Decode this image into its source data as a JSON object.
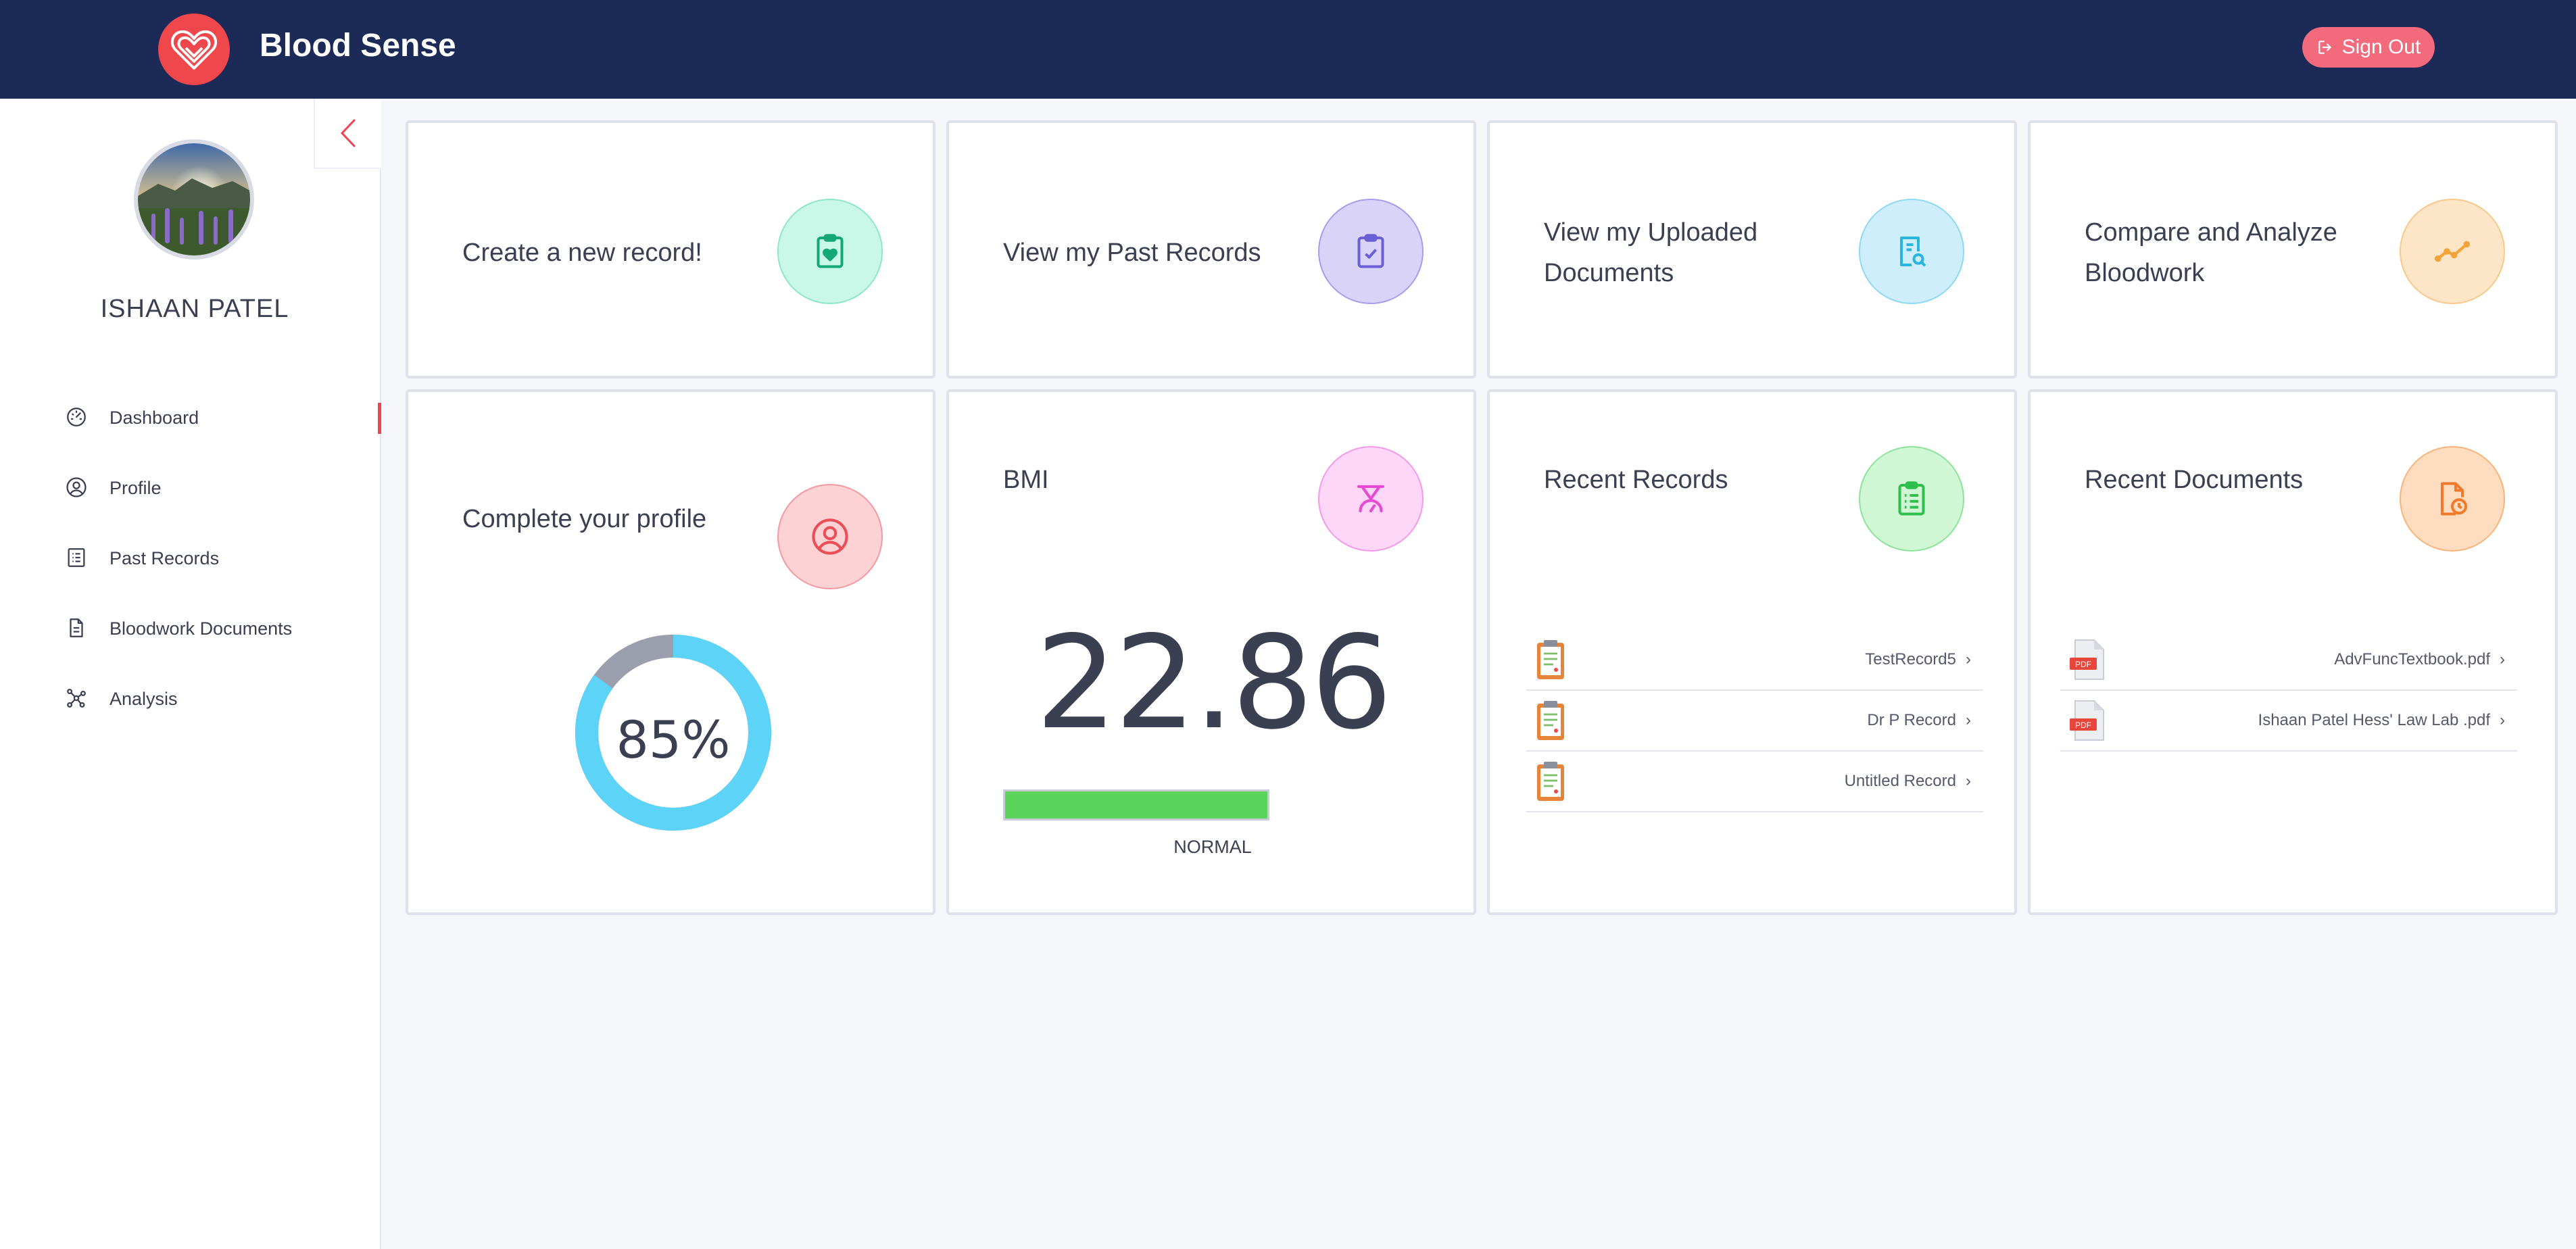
{
  "header": {
    "brand": "Blood Sense",
    "sign_out": "Sign Out"
  },
  "sidebar": {
    "username": "ISHAAN PATEL",
    "items": [
      {
        "label": "Dashboard",
        "icon": "dashboard-gauge-icon",
        "active": true
      },
      {
        "label": "Profile",
        "icon": "user-circle-icon",
        "active": false
      },
      {
        "label": "Past Records",
        "icon": "list-icon",
        "active": false
      },
      {
        "label": "Bloodwork Documents",
        "icon": "document-icon",
        "active": false
      },
      {
        "label": "Analysis",
        "icon": "network-nodes-icon",
        "active": false
      }
    ]
  },
  "actions": [
    {
      "title": "Create a new record!",
      "icon": "clipboard-heart-icon",
      "bg": "#c9f7e8",
      "color": "#15a877"
    },
    {
      "title": "View my Past Records",
      "icon": "clipboard-check-icon",
      "bg": "#d9d4f7",
      "color": "#6b5fd6"
    },
    {
      "title": "View my Uploaded Documents",
      "icon": "document-search-icon",
      "bg": "#cfeefb",
      "color": "#28b6e0"
    },
    {
      "title": "Compare and Analyze Bloodwork",
      "icon": "trend-line-icon",
      "bg": "#fde6c8",
      "color": "#f0a43a"
    }
  ],
  "profile_card": {
    "title": "Complete your profile",
    "percent_label": "85%",
    "percent": 85,
    "icon": "user-circle-icon",
    "colors": {
      "done": "#5dd3f8",
      "remaining": "#9b9fad"
    }
  },
  "bmi_card": {
    "title": "BMI",
    "value": "22.86",
    "status": "NORMAL",
    "icon": "scale-icon",
    "bar_color": "#5cd45c"
  },
  "recent_records": {
    "title": "Recent Records",
    "icon": "clipboard-list-icon",
    "items": [
      "TestRecord5",
      "Dr P Record",
      "Untitled Record"
    ]
  },
  "recent_documents": {
    "title": "Recent Documents",
    "icon": "document-clock-icon",
    "items": [
      "AdvFuncTextbook.pdf",
      "Ishaan Patel Hess' Law Lab .pdf"
    ]
  },
  "colors": {
    "topbar": "#1b2a57",
    "accent": "#f0474d",
    "sign_out": "#f26a7c",
    "background": "#f5f6fa"
  }
}
